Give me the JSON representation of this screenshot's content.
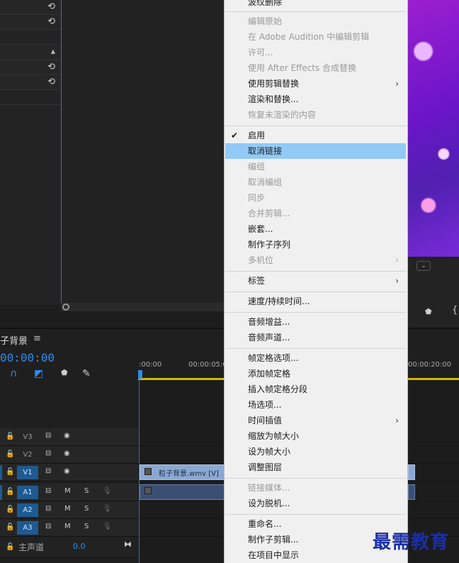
{
  "sequence": {
    "title": "子背景",
    "timecode": "00:00:00"
  },
  "ruler": {
    "labels": [
      ":00:00",
      "00:00:05:00",
      "00:00:20:00"
    ]
  },
  "tracks": {
    "video": [
      {
        "id": "V3",
        "targeted": false
      },
      {
        "id": "V2",
        "targeted": false
      },
      {
        "id": "V1",
        "targeted": true
      }
    ],
    "audio": [
      {
        "id": "A1",
        "m": "M",
        "s": "S"
      },
      {
        "id": "A2",
        "m": "M",
        "s": "S"
      },
      {
        "id": "A3",
        "m": "M",
        "s": "S"
      }
    ],
    "master": {
      "label": "主声道",
      "value": "0.0"
    }
  },
  "clip": {
    "video_name": "粒子背景.wmv [V]"
  },
  "context_menu": {
    "items": [
      {
        "label": "波纹删除",
        "enabled": true
      },
      {
        "label": "编辑原始",
        "enabled": false
      },
      {
        "label": "在 Adobe Audition 中编辑剪辑",
        "enabled": false
      },
      {
        "label": "许可...",
        "enabled": false
      },
      {
        "label": "使用 After Effects 合成替换",
        "enabled": false
      },
      {
        "label": "使用剪辑替换",
        "enabled": true,
        "submenu": true
      },
      {
        "label": "渲染和替换...",
        "enabled": true
      },
      {
        "label": "恢复未渲染的内容",
        "enabled": false
      },
      {
        "label": "启用",
        "enabled": true,
        "checked": true
      },
      {
        "label": "取消链接",
        "enabled": true,
        "highlighted": true
      },
      {
        "label": "编组",
        "enabled": false
      },
      {
        "label": "取消编组",
        "enabled": false
      },
      {
        "label": "同步",
        "enabled": false
      },
      {
        "label": "合并剪辑...",
        "enabled": false
      },
      {
        "label": "嵌套...",
        "enabled": true
      },
      {
        "label": "制作子序列",
        "enabled": true
      },
      {
        "label": "多机位",
        "enabled": false,
        "submenu": true
      },
      {
        "label": "标签",
        "enabled": true,
        "submenu": true
      },
      {
        "label": "速度/持续时间...",
        "enabled": true
      },
      {
        "label": "音频增益...",
        "enabled": true
      },
      {
        "label": "音频声道...",
        "enabled": true
      },
      {
        "label": "帧定格选项...",
        "enabled": true
      },
      {
        "label": "添加帧定格",
        "enabled": true
      },
      {
        "label": "插入帧定格分段",
        "enabled": true
      },
      {
        "label": "场选项...",
        "enabled": true
      },
      {
        "label": "时间插值",
        "enabled": true,
        "submenu": true
      },
      {
        "label": "缩放为帧大小",
        "enabled": true
      },
      {
        "label": "设为帧大小",
        "enabled": true
      },
      {
        "label": "调整图层",
        "enabled": true
      },
      {
        "label": "链接媒体...",
        "enabled": false
      },
      {
        "label": "设为脱机...",
        "enabled": true
      },
      {
        "label": "重命名...",
        "enabled": true
      },
      {
        "label": "制作子剪辑...",
        "enabled": true
      },
      {
        "label": "在项目中显示",
        "enabled": true
      }
    ]
  },
  "icons": {
    "reset": "reset-icon",
    "check": "checkmark-icon",
    "submenu": "chevron-right-icon"
  },
  "colors": {
    "accent": "#2d8ceb",
    "highlight": "#91c9f7",
    "work_area": "#d4b600"
  },
  "watermark": "最需教育"
}
